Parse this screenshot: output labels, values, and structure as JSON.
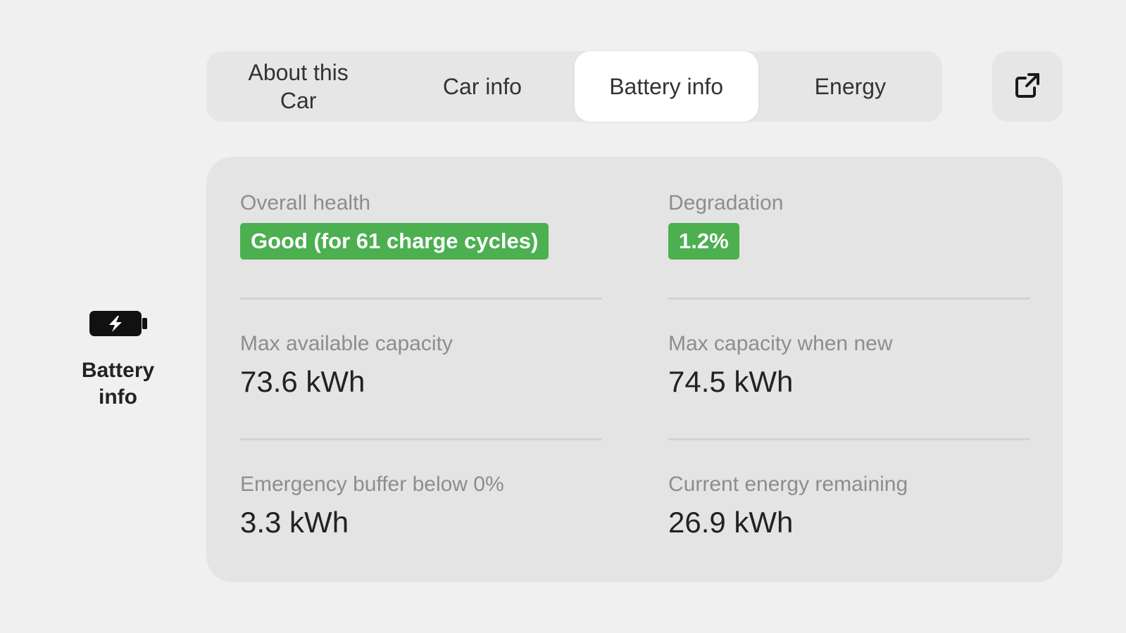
{
  "side_nav": {
    "item": {
      "icon": "battery-charging-icon",
      "label": "Battery info"
    }
  },
  "tabs": [
    {
      "label": "About this Car",
      "active": false
    },
    {
      "label": "Car info",
      "active": false
    },
    {
      "label": "Battery info",
      "active": true
    },
    {
      "label": "Energy",
      "active": false
    }
  ],
  "external_link": {
    "icon": "external-link-icon"
  },
  "battery": {
    "overall_health": {
      "label": "Overall health",
      "value": "Good (for 61 charge cycles)"
    },
    "degradation": {
      "label": "Degradation",
      "value": "1.2%"
    },
    "max_available_capacity": {
      "label": "Max available capacity",
      "value": "73.6 kWh"
    },
    "max_capacity_new": {
      "label": "Max capacity when new",
      "value": "74.5 kWh"
    },
    "emergency_buffer": {
      "label": "Emergency buffer below 0%",
      "value": "3.3 kWh"
    },
    "current_energy": {
      "label": "Current energy remaining",
      "value": "26.9 kWh"
    }
  },
  "colors": {
    "background": "#f0f0f0",
    "card": "#e4e4e4",
    "badge_green": "#4caf50",
    "label_gray": "#8d8d8d"
  }
}
